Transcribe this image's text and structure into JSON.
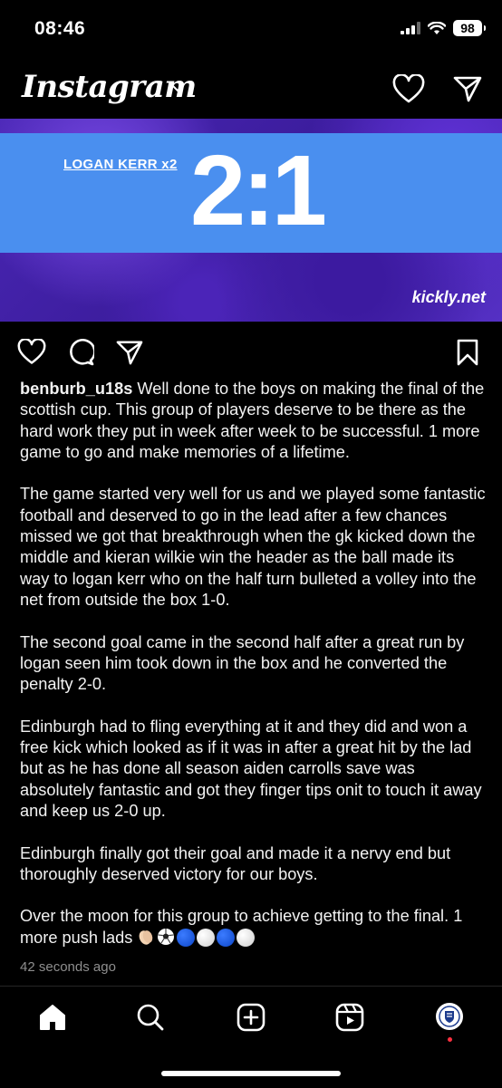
{
  "status_bar": {
    "time": "08:46",
    "battery": "98"
  },
  "header": {
    "logo": "Instagram"
  },
  "post_image": {
    "scorer": "LOGAN KERR x2",
    "score": "2:1",
    "brand": "kickly.net"
  },
  "caption": {
    "username": "benburb_u18s",
    "paragraph_1": " Well done to the boys on making the final of the scottish cup. This group of players deserve to be there as the hard work they put in week after week to be successful. 1 more game to go and make memories of a lifetime.",
    "paragraph_2": "The game started very well for us and we played some fantastic football and deserved to go in the lead after a few chances missed we got that breakthrough when the gk kicked down the middle and kieran wilkie win the header as the ball made its way to logan kerr who on the half turn bulleted a volley into the net from outside the box 1-0.",
    "paragraph_3": "The second goal came in the second half after a great run by logan seen him took down in the box and he converted the penalty 2-0.",
    "paragraph_4": "Edinburgh had to fling everything at it and they did  and won a free kick which looked as if it was in after a great hit by the lad but as he has done all season aiden carrolls save was absolutely fantastic and got they finger tips onit to touch it away and keep us 2-0 up.",
    "paragraph_5": "Edinburgh finally got their goal and made it a nervy end but thoroughly deserved victory for our boys.",
    "paragraph_6": "Over the moon for this group to achieve getting to the final. 1 more push lads ",
    "emoji_sequence": [
      "clapping-hands-emoji",
      "soccer-ball-emoji",
      "blue-circle-emoji",
      "white-circle-emoji",
      "blue-circle-emoji",
      "white-circle-emoji"
    ],
    "time_ago": "42 seconds ago"
  },
  "colors": {
    "score_band": "#4a8fef",
    "purple_bg": "#4a27b5",
    "notification": "#ff3040"
  }
}
